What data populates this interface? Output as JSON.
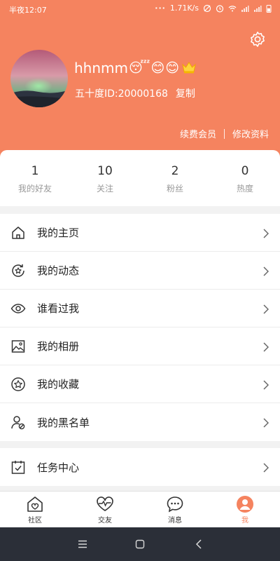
{
  "status_bar": {
    "time": "半夜12:07",
    "speed": "1.71K/s"
  },
  "profile": {
    "username": "hhnmm",
    "emojis": [
      "😴",
      "😊",
      "😊"
    ],
    "id_text": "五十度ID:20000168",
    "copy_label": "复制",
    "renew_label": "续费会员",
    "edit_label": "修改资料"
  },
  "stats": [
    {
      "value": "1",
      "label": "我的好友"
    },
    {
      "value": "10",
      "label": "关注"
    },
    {
      "value": "2",
      "label": "粉丝"
    },
    {
      "value": "0",
      "label": "热度"
    }
  ],
  "menu": [
    {
      "label": "我的主页",
      "icon": "home-icon"
    },
    {
      "label": "我的动态",
      "icon": "star-refresh-icon"
    },
    {
      "label": "谁看过我",
      "icon": "eye-icon"
    },
    {
      "label": "我的相册",
      "icon": "photo-icon"
    },
    {
      "label": "我的收藏",
      "icon": "star-circle-icon"
    },
    {
      "label": "我的黑名单",
      "icon": "blocked-user-icon"
    },
    {
      "label": "任务中心",
      "icon": "calendar-check-icon"
    }
  ],
  "nav": [
    {
      "label": "社区",
      "icon": "community-house-icon"
    },
    {
      "label": "交友",
      "icon": "heart-pulse-icon"
    },
    {
      "label": "消息",
      "icon": "chat-bubble-icon"
    },
    {
      "label": "我",
      "icon": "user-icon"
    }
  ],
  "colors": {
    "accent": "#f5835f",
    "text": "#222222",
    "muted": "#999999",
    "system_bar": "#2b2f38"
  }
}
